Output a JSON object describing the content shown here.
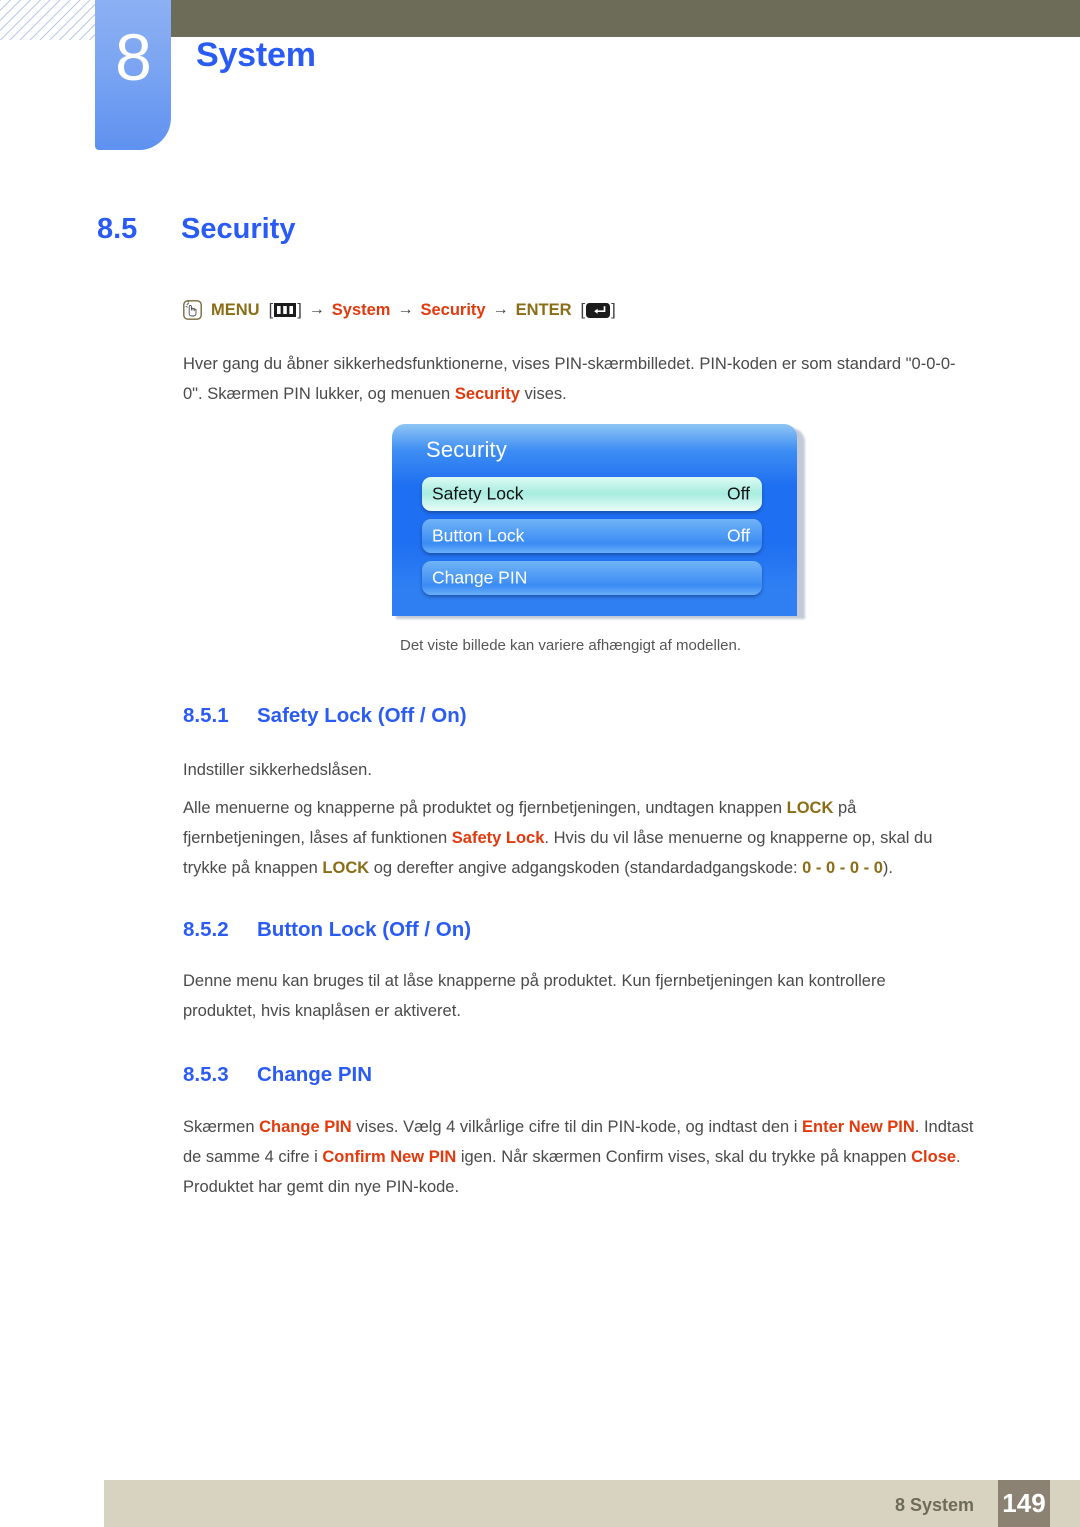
{
  "header": {
    "chapter_number": "8",
    "chapter_title": "System"
  },
  "section": {
    "number": "8.5",
    "title": "Security"
  },
  "breadcrumb": {
    "hand_icon": "hand-press-icon",
    "menu_label": "MENU",
    "menu_open_bracket": "[",
    "menu_icon": "menu-bars-icon",
    "menu_close_bracket": "]",
    "arrow": "→",
    "path_system": "System",
    "path_security": "Security",
    "enter_label": "ENTER",
    "enter_open_bracket": "[",
    "enter_icon": "enter-return-icon",
    "enter_close_bracket": "]"
  },
  "intro": {
    "t1": "Hver gang du åbner sikkerhedsfunktionerne, vises PIN-skærmbilledet. PIN-koden er som standard \"0-0-0-0\". Skærmen PIN lukker, og menuen ",
    "hl1": "Security",
    "t2": " vises."
  },
  "osd": {
    "title": "Security",
    "rows": [
      {
        "label": "Safety Lock",
        "value": "Off",
        "selected": true
      },
      {
        "label": "Button Lock",
        "value": "Off",
        "selected": false
      },
      {
        "label": "Change PIN",
        "value": "",
        "selected": false
      }
    ],
    "caption": "Det viste billede kan variere afhængigt af modellen."
  },
  "sub851": {
    "number": "8.5.1",
    "title": "Safety Lock (Off / On)",
    "p1": "Indstiller sikkerhedslåsen.",
    "p2_t1": "Alle menuerne og knapperne på produktet og fjernbetjeningen, undtagen knappen ",
    "p2_hl1": "LOCK",
    "p2_t2": " på fjernbetjeningen, låses af funktionen ",
    "p2_hl2": "Safety Lock",
    "p2_t3": ". Hvis du vil låse menuerne og knapperne op, skal du trykke på knappen ",
    "p2_hl3": "LOCK",
    "p2_t4": " og derefter angive adgangskoden (standardadgangskode: ",
    "p2_hl4": "0 - 0 - 0 - 0",
    "p2_t5": ")."
  },
  "sub852": {
    "number": "8.5.2",
    "title": "Button Lock (Off / On)",
    "p1": "Denne menu kan bruges til at låse knapperne på produktet. Kun fjernbetjeningen kan kontrollere produktet, hvis knaplåsen er aktiveret."
  },
  "sub853": {
    "number": "8.5.3",
    "title": "Change PIN",
    "p_t1": "Skærmen ",
    "p_hl1": "Change PIN",
    "p_t2": " vises. Vælg 4 vilkårlige cifre til din PIN-kode, og indtast den i ",
    "p_hl2": "Enter New PIN",
    "p_t3": ". Indtast de samme 4 cifre i ",
    "p_hl3": "Confirm New PIN",
    "p_t4": " igen. Når skærmen Confirm vises, skal du trykke på knappen ",
    "p_hl4": "Close",
    "p_t5": ". Produktet har gemt din nye PIN-kode."
  },
  "footer": {
    "label": "8 System",
    "page_number": "149"
  },
  "colors": {
    "accent_blue": "#2a5cf5",
    "highlight_red": "#e2390d",
    "highlight_gold": "#8a6d17",
    "header_olive": "#6d6c58",
    "footer_beige": "#d8d3c1",
    "footer_page_box": "#8b8273"
  }
}
